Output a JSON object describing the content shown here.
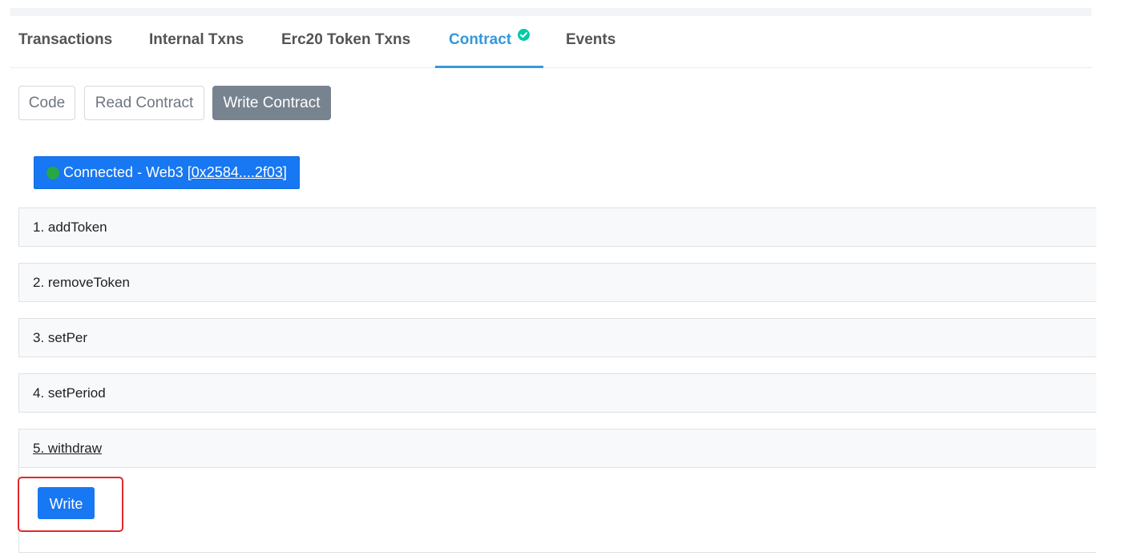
{
  "tabs": [
    {
      "label": "Transactions",
      "active": false
    },
    {
      "label": "Internal Txns",
      "active": false
    },
    {
      "label": "Erc20 Token Txns",
      "active": false
    },
    {
      "label": "Contract",
      "active": true,
      "badge_icon": "check-circle-icon"
    },
    {
      "label": "Events",
      "active": false
    }
  ],
  "contract_views": [
    {
      "label": "Code",
      "active": false
    },
    {
      "label": "Read Contract",
      "active": false
    },
    {
      "label": "Write Contract",
      "active": true
    }
  ],
  "connection": {
    "status_text": "Connected - Web3",
    "address": "[0x2584....2f03]",
    "status_color": "#28a745"
  },
  "functions": [
    {
      "label": "1. addToken"
    },
    {
      "label": "2. removeToken"
    },
    {
      "label": "3. setPer"
    },
    {
      "label": "4. setPeriod"
    },
    {
      "label": "5. withdraw",
      "expanded": true
    }
  ],
  "write_button_label": "Write",
  "colors": {
    "accent": "#3498db",
    "primary_button": "#1877f2",
    "verified": "#00c9a7",
    "highlight": "#e0292b"
  }
}
